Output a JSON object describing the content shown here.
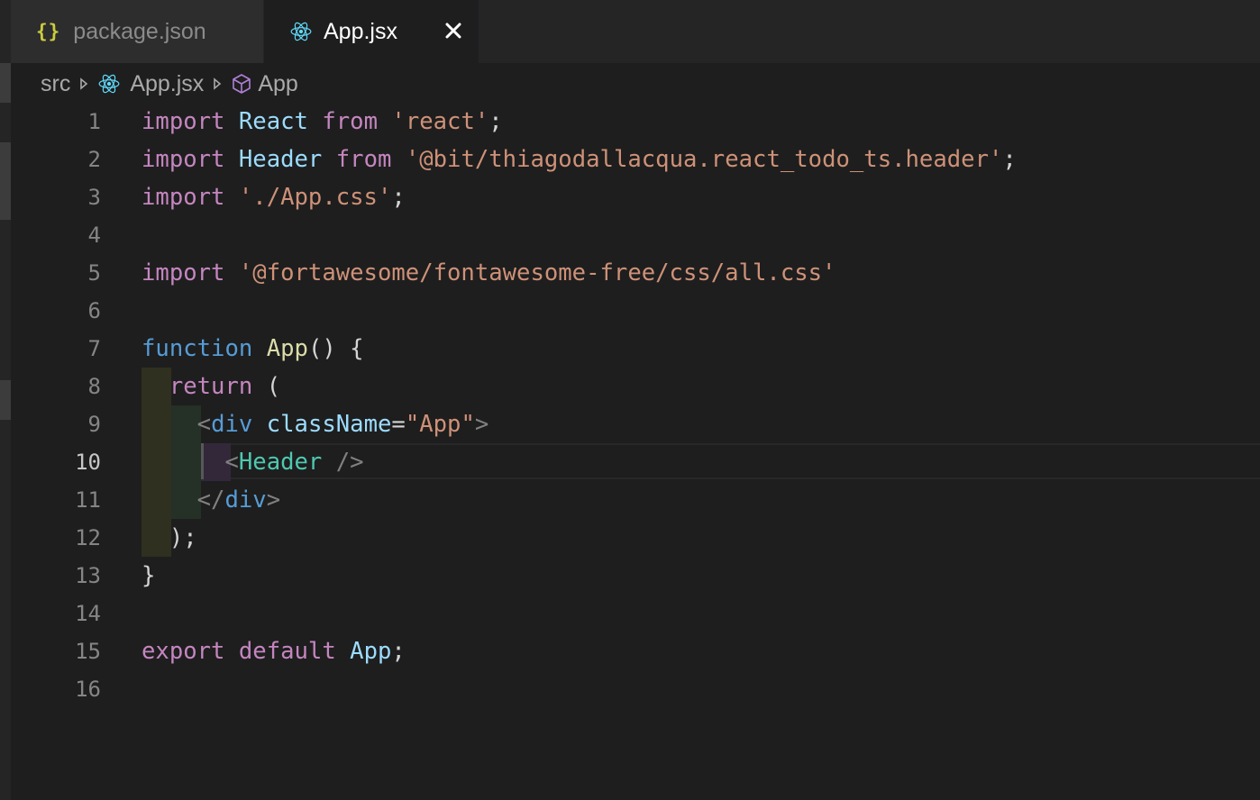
{
  "tabs": [
    {
      "label": "package.json",
      "icon": "json-braces-icon",
      "active": false,
      "icon_text": "{}"
    },
    {
      "label": "App.jsx",
      "icon": "react-icon",
      "active": true
    }
  ],
  "breadcrumb": {
    "items": [
      {
        "label": "src"
      },
      {
        "label": "App.jsx",
        "icon": "react-icon"
      },
      {
        "label": "App",
        "icon": "symbol-cube-icon"
      }
    ]
  },
  "editor": {
    "active_line": 10,
    "line_numbers": [
      "1",
      "2",
      "3",
      "4",
      "5",
      "6",
      "7",
      "8",
      "9",
      "10",
      "11",
      "12",
      "13",
      "14",
      "15",
      "16"
    ],
    "lines": [
      "import React from 'react';",
      "import Header from '@bit/thiagodallacqua.react_todo_ts.header';",
      "import './App.css';",
      "",
      "import '@fortawesome/fontawesome-free/css/all.css'",
      "",
      "function App() {",
      "  return (",
      "    <div className=\"App\">",
      "      <Header />",
      "    </div>",
      "  );",
      "}",
      "",
      "export default App;",
      ""
    ]
  },
  "colors": {
    "background": "#1e1e1e",
    "keyword_pink": "#c586c0",
    "keyword_blue": "#569cd6",
    "identifier": "#9cdcfe",
    "string": "#ce9178",
    "function": "#dcdcaa",
    "component": "#4ec9b0",
    "json_icon": "#cbcb41",
    "react_icon": "#61dafb"
  }
}
